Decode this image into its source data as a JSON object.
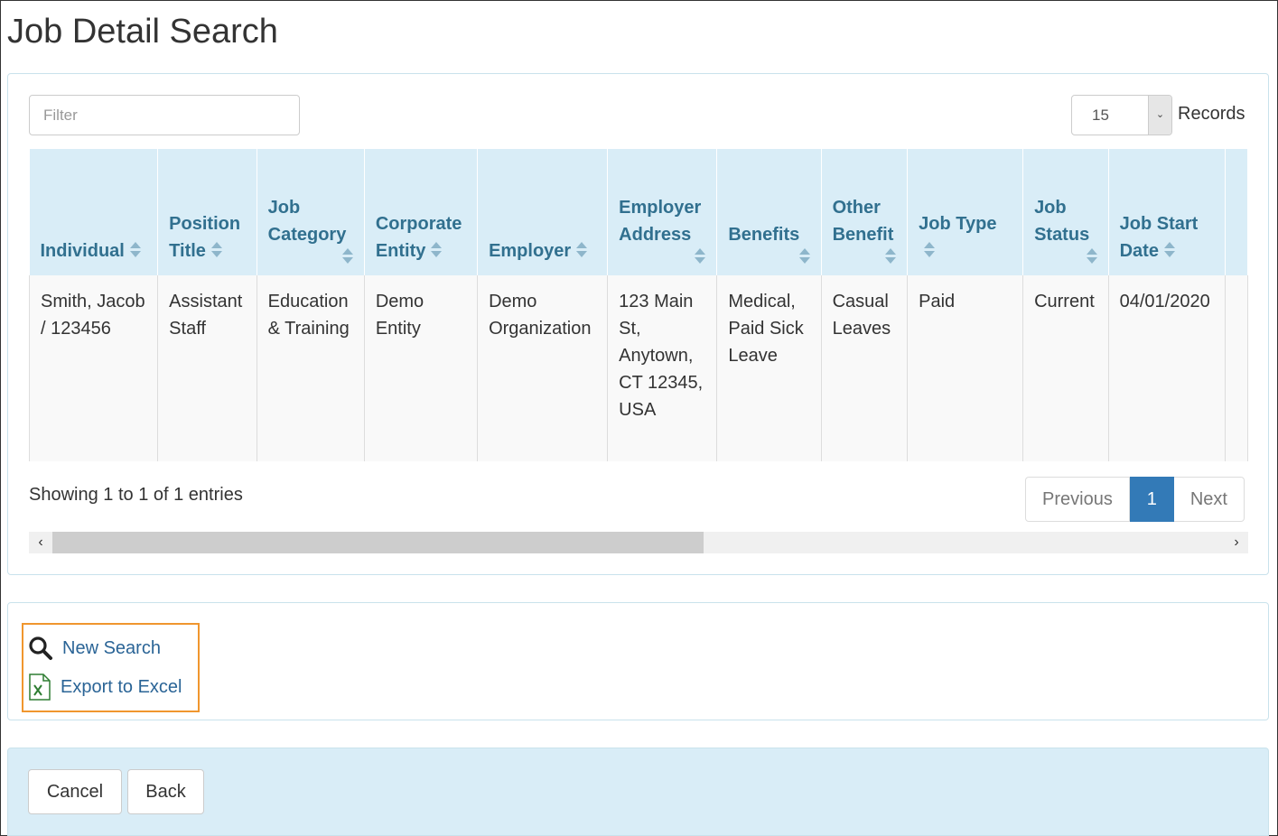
{
  "page": {
    "title": "Job Detail Search"
  },
  "filter": {
    "placeholder": "Filter",
    "value": ""
  },
  "records": {
    "selected": "15",
    "label": "Records"
  },
  "table": {
    "columns": [
      {
        "label": "Individual",
        "sort_position": "inline"
      },
      {
        "label": "Position Title",
        "sort_position": "inline"
      },
      {
        "label": "Job Category",
        "sort_position": "below"
      },
      {
        "label": "Corporate Entity",
        "sort_position": "inline"
      },
      {
        "label": "Employer",
        "sort_position": "inline"
      },
      {
        "label": "Employer Address",
        "sort_position": "below"
      },
      {
        "label": "Benefits",
        "sort_position": "below"
      },
      {
        "label": "Other Benefit",
        "sort_position": "below"
      },
      {
        "label": "Job Type",
        "sort_position": "inline"
      },
      {
        "label": "Job Status",
        "sort_position": "below"
      },
      {
        "label": "Job Start Date",
        "sort_position": "inline"
      }
    ],
    "rows": [
      {
        "cells": [
          "Smith, Jacob / 123456",
          "Assistant Staff",
          "Education & Training",
          "Demo Entity",
          "Demo Organization",
          "123 Main St, Anytown, CT 12345, USA",
          "Medical, Paid Sick Leave",
          "Casual Leaves",
          "Paid",
          "Current",
          "04/01/2020"
        ]
      }
    ]
  },
  "info": {
    "showing": "Showing 1 to 1 of 1 entries"
  },
  "pagination": {
    "previous": "Previous",
    "current": "1",
    "next": "Next"
  },
  "scrollbar": {
    "left_arrow": "‹",
    "right_arrow": "›"
  },
  "actions": {
    "new_search": "New Search",
    "export_excel": "Export to Excel"
  },
  "footer": {
    "cancel": "Cancel",
    "back": "Back"
  },
  "colors": {
    "header_bg": "#d9edf7",
    "header_text": "#31708f",
    "link": "#2a6496",
    "active_page": "#337ab7",
    "highlight_border": "#f0962e",
    "excel_green": "#2e7d32"
  },
  "icons": {
    "search": "search-icon",
    "excel": "excel-file-icon",
    "sort": "sort-icon",
    "dropdown": "chevron-down-icon"
  }
}
